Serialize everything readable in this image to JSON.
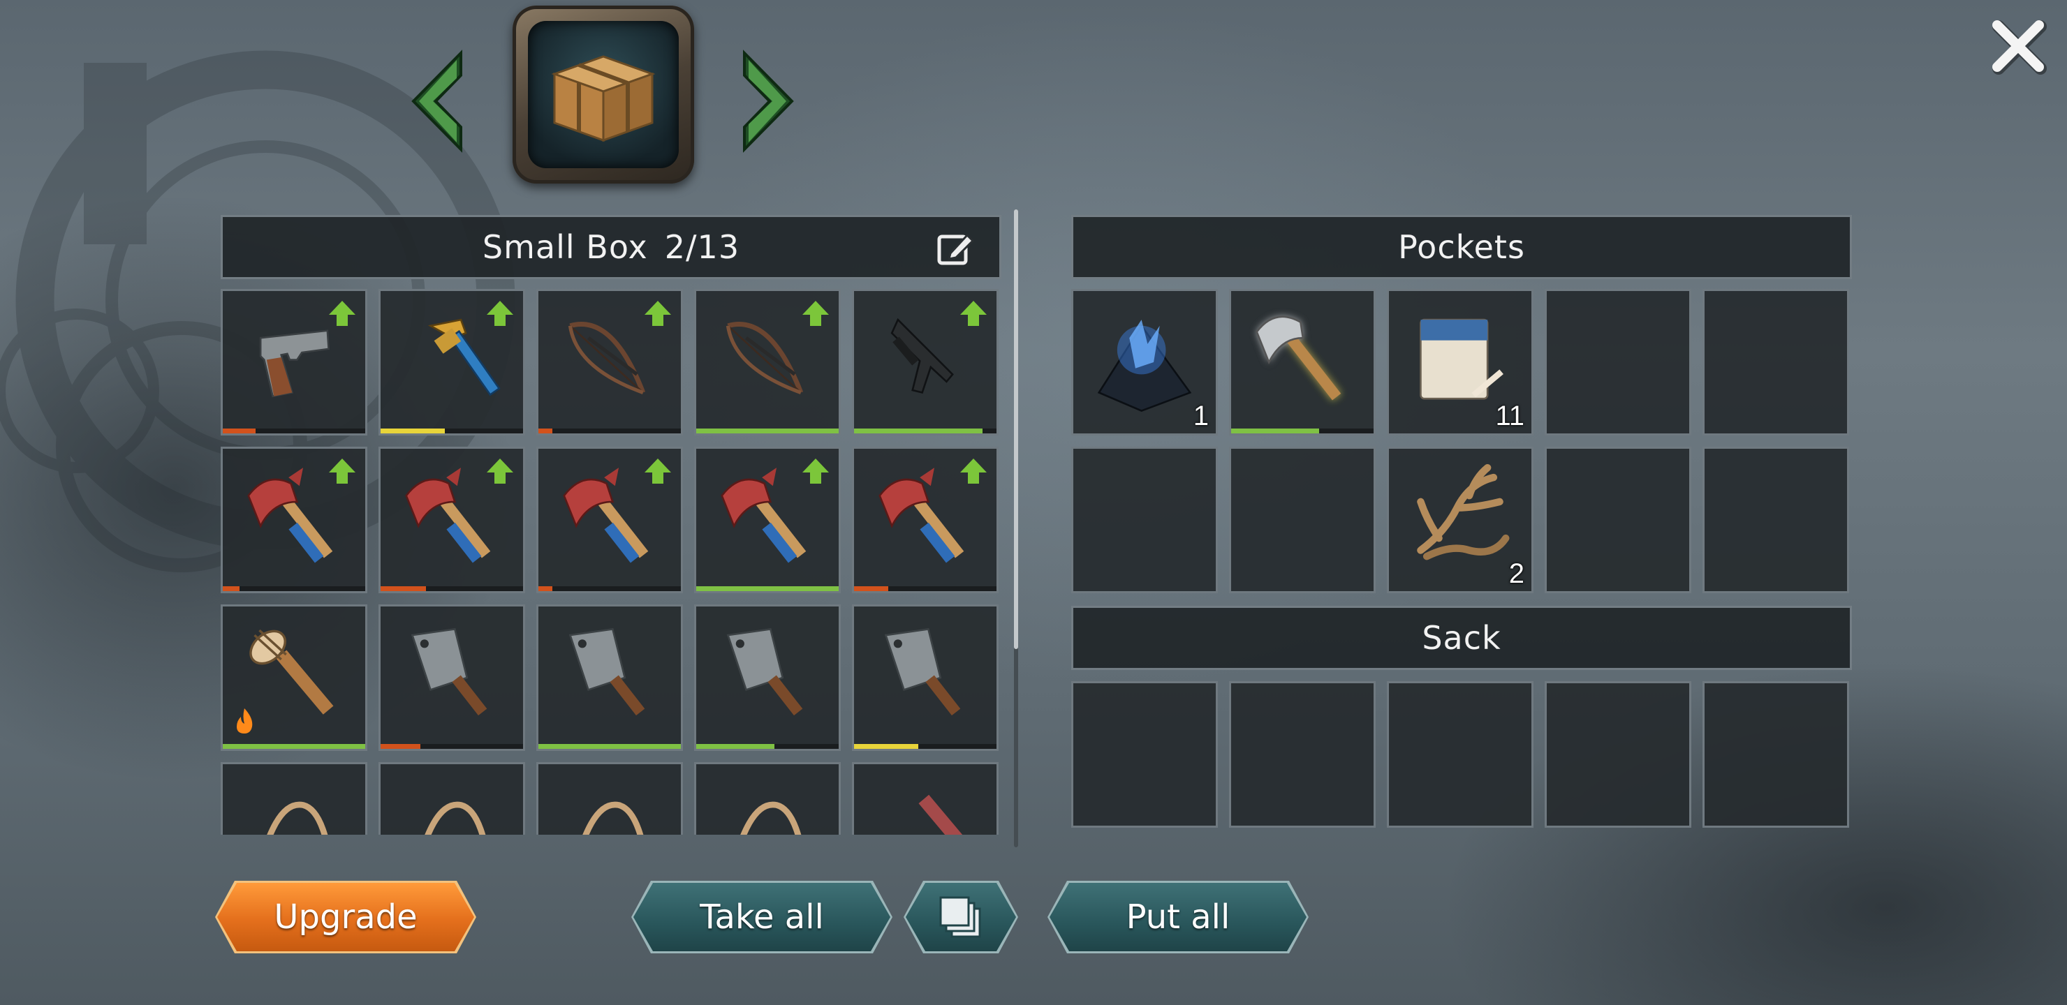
{
  "container": {
    "name": "Small Box",
    "capacity": "2/13",
    "icon": "wooden-crate-icon"
  },
  "panels": {
    "pockets_title": "Pockets",
    "sack_title": "Sack"
  },
  "buttons": {
    "upgrade": "Upgrade",
    "take_all": "Take all",
    "put_all": "Put all"
  },
  "colors": {
    "upgrade_button": "#e46f1c",
    "action_button": "#29565b",
    "upgrade_arrow": "#7cc63a",
    "durability_green": "#7fc144",
    "durability_yellow": "#e8d43a",
    "durability_red": "#d2521c"
  },
  "box_items": [
    {
      "icon": "pistol-icon",
      "upgrade": true,
      "durability": 0.23,
      "dur_color": "#d2521c"
    },
    {
      "icon": "pipe-wrench-icon",
      "upgrade": true,
      "durability": 0.45,
      "dur_color": "#e8d43a"
    },
    {
      "icon": "crossbow-icon",
      "upgrade": true,
      "durability": 0.1,
      "dur_color": "#d2521c"
    },
    {
      "icon": "crossbow-icon",
      "upgrade": true,
      "durability": 1.0,
      "dur_color": "#7fc144"
    },
    {
      "icon": "submachine-gun-icon",
      "upgrade": true,
      "durability": 0.9,
      "dur_color": "#7fc144"
    },
    {
      "icon": "fire-axe-icon",
      "upgrade": true,
      "durability": 0.12,
      "dur_color": "#d2521c"
    },
    {
      "icon": "fire-axe-icon",
      "upgrade": true,
      "durability": 0.32,
      "dur_color": "#d2521c"
    },
    {
      "icon": "fire-axe-icon",
      "upgrade": true,
      "durability": 0.1,
      "dur_color": "#d2521c"
    },
    {
      "icon": "fire-axe-icon",
      "upgrade": true,
      "durability": 1.0,
      "dur_color": "#7fc144"
    },
    {
      "icon": "fire-axe-icon",
      "upgrade": true,
      "durability": 0.24,
      "dur_color": "#d2521c"
    },
    {
      "icon": "spiked-club-icon",
      "upgrade": false,
      "durability": 1.0,
      "dur_color": "#7fc144",
      "fire": true
    },
    {
      "icon": "cleaver-icon",
      "upgrade": false,
      "durability": 0.28,
      "dur_color": "#d2521c"
    },
    {
      "icon": "cleaver-icon",
      "upgrade": false,
      "durability": 1.0,
      "dur_color": "#7fc144"
    },
    {
      "icon": "cleaver-icon",
      "upgrade": false,
      "durability": 0.55,
      "dur_color": "#7fc144"
    },
    {
      "icon": "cleaver-icon",
      "upgrade": false,
      "durability": 0.45,
      "dur_color": "#e8d43a"
    },
    {
      "icon": "rope-icon"
    },
    {
      "icon": "rope-icon"
    },
    {
      "icon": "rope-icon"
    },
    {
      "icon": "rope-icon"
    },
    {
      "icon": "baseball-bat-icon"
    }
  ],
  "pocket_items": [
    {
      "icon": "blue-crystal-ore-icon",
      "count": "1"
    },
    {
      "icon": "hatchet-icon",
      "durability": 0.62,
      "dur_color": "#7fc144",
      "glow": true
    },
    {
      "icon": "cigarette-pack-icon",
      "count": "11"
    },
    {
      "icon": "empty-slot"
    },
    {
      "icon": "empty-slot"
    },
    {
      "icon": "empty-slot"
    },
    {
      "icon": "empty-slot"
    },
    {
      "icon": "antlers-icon",
      "count": "2"
    },
    {
      "icon": "empty-slot"
    },
    {
      "icon": "empty-slot"
    }
  ],
  "sack_items": [
    {
      "icon": "empty-slot"
    },
    {
      "icon": "empty-slot"
    },
    {
      "icon": "empty-slot"
    },
    {
      "icon": "empty-slot"
    },
    {
      "icon": "empty-slot"
    }
  ]
}
